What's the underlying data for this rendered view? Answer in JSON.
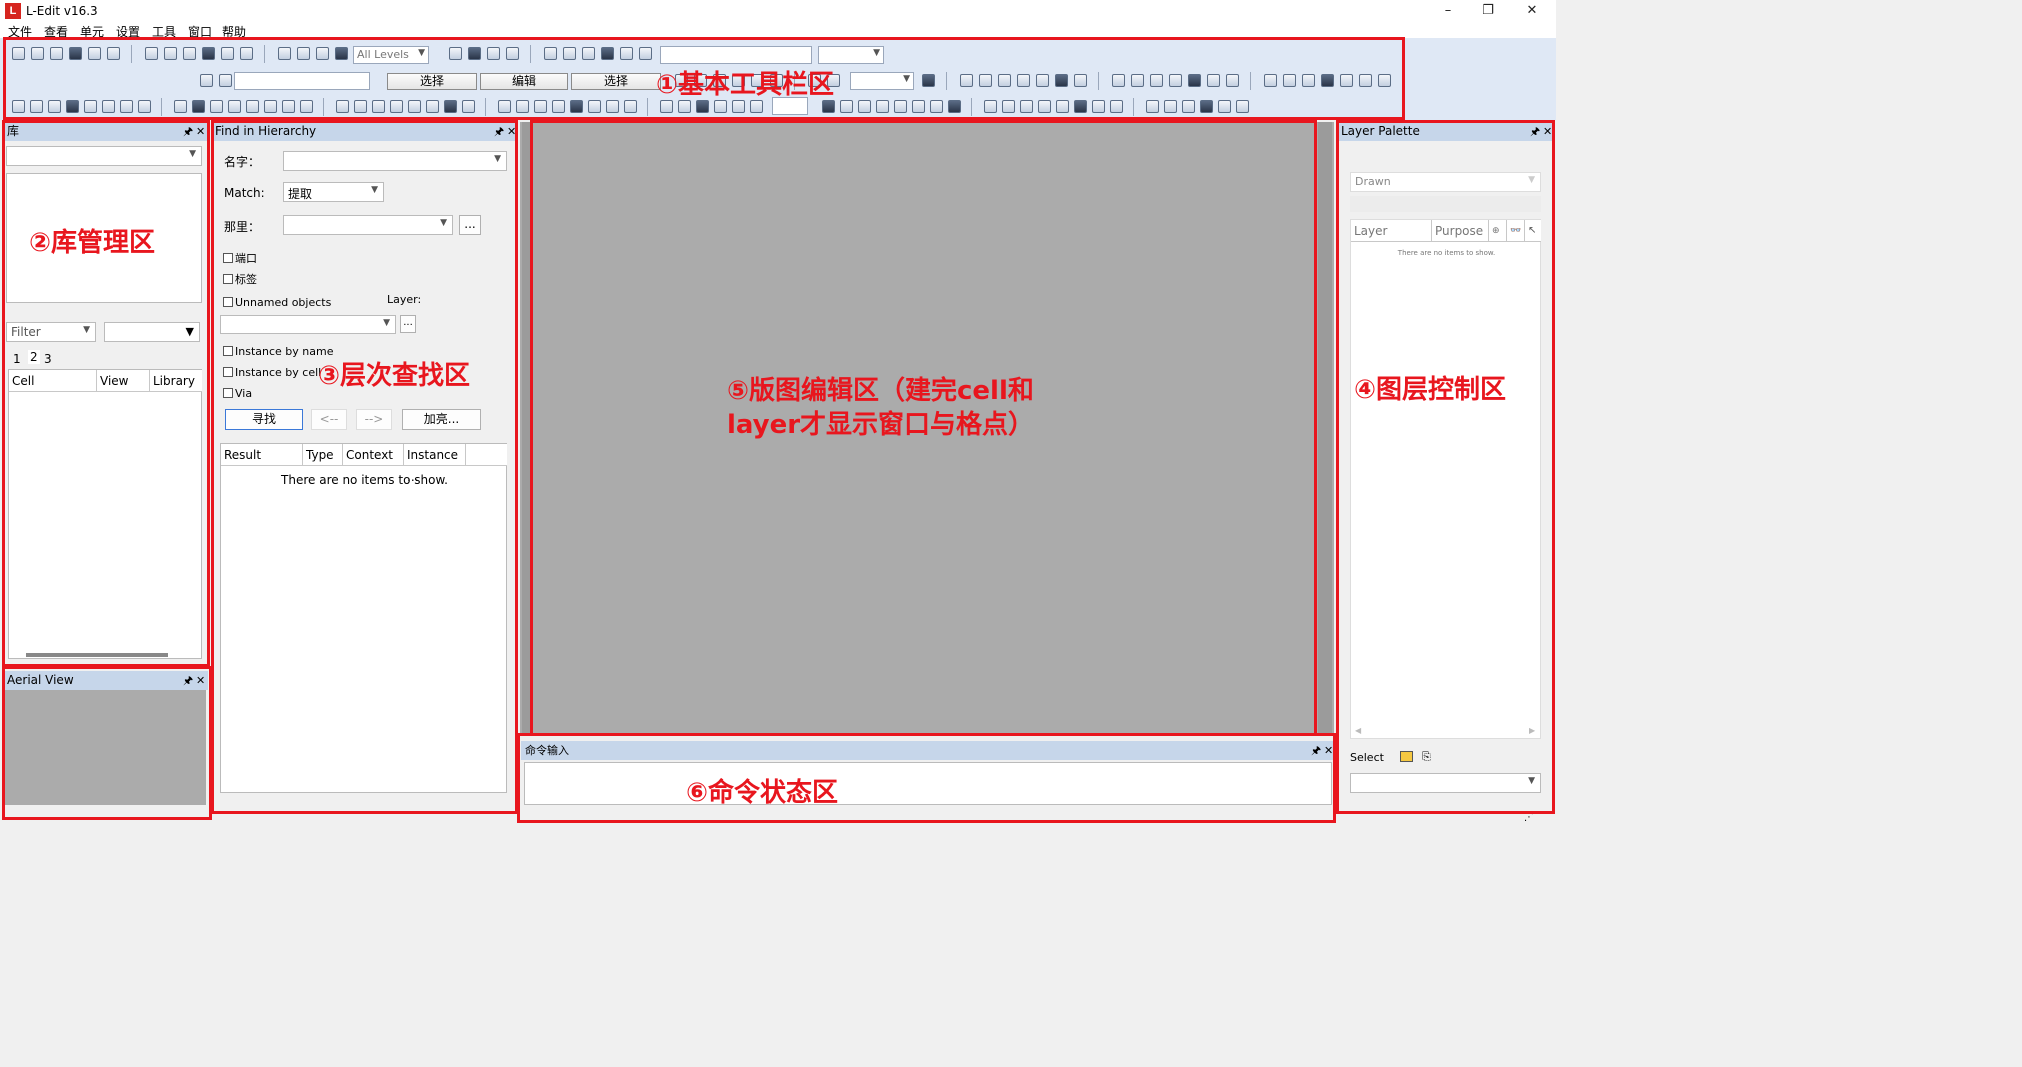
{
  "window": {
    "title": "L-Edit v16.3",
    "app_icon_letter": "L",
    "min": "–",
    "restore": "❐",
    "close": "✕"
  },
  "menu": [
    "文件",
    "查看",
    "单元",
    "设置",
    "工具",
    "窗口",
    "帮助"
  ],
  "toolbar": {
    "levels_combo": "All Levels",
    "select_tab_1": "选择",
    "edit_tab": "编辑",
    "select_tab_2": "选择"
  },
  "library_panel": {
    "title": "库",
    "filter_placeholder": "Filter",
    "page_tabs": [
      "1",
      "2",
      "3"
    ],
    "columns": [
      "Cell",
      "View",
      "Library"
    ]
  },
  "aerial_panel": {
    "title": "Aerial View"
  },
  "find_panel": {
    "title": "Find in Hierarchy",
    "name_label": "名字：",
    "match_label": "Match:",
    "match_value": "提取",
    "where_label": "那里：",
    "browse": "...",
    "chk_port": "端口",
    "chk_label": "标签",
    "chk_unnamed": "Unnamed objects",
    "layer_label": "Layer:",
    "chk_instance_name": "Instance by name",
    "chk_instance_cell": "Instance by cell",
    "chk_via": "Via",
    "btn_find": "寻找",
    "btn_prev": "<--",
    "btn_next": "-->",
    "btn_highlight": "加亮...",
    "columns": [
      "Result",
      "Type",
      "Context",
      "Instance ..."
    ],
    "empty_msg": "There are no items to show."
  },
  "layer_palette": {
    "title": "Layer Palette",
    "mode": "Drawn",
    "columns": [
      "Layer",
      "Purpose"
    ],
    "empty_msg": "There are no items to show.",
    "select_label": "Select"
  },
  "command_panel": {
    "title": "命令输入"
  },
  "annotations": {
    "toolbar": "①基本工具栏区",
    "library": "②库管理区",
    "hierarchy": "③层次查找区",
    "layer": "④图层控制区",
    "layout_line1": "⑤版图编辑区（建完cell和",
    "layout_line2": "layer才显示窗口与格点）",
    "command": "⑥命令状态区"
  },
  "colors": {
    "annotation_red": "#e8161e",
    "panel_header": "#c6d6ea",
    "canvas_gray": "#ababab",
    "toolbar_bg": "#dfe8f5"
  }
}
